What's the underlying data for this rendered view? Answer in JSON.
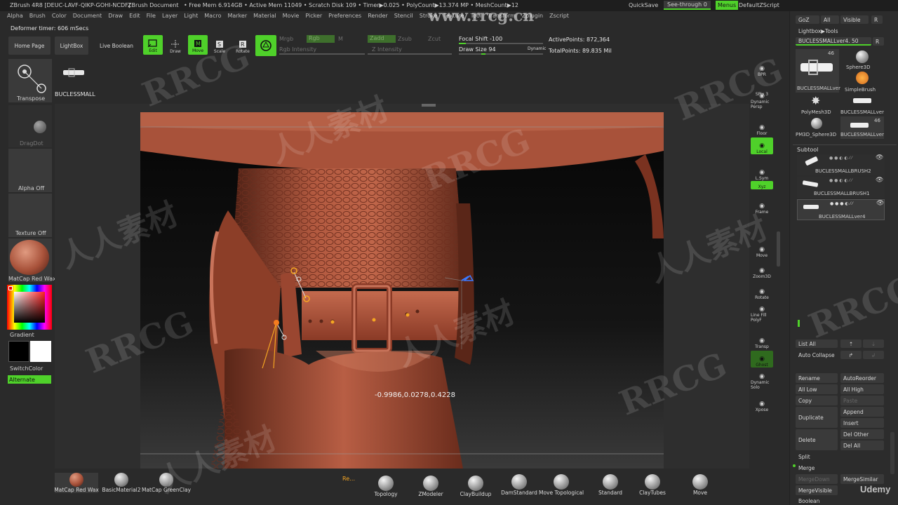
{
  "titlebar": {
    "title": "ZBrush 4R8 [DEUC-LAVF-QIKP-GOHI-NCDF]",
    "document": "ZBrush Document",
    "stats": "• Free Mem 6.914GB • Active Mem 11049 • Scratch Disk 109 • Timer▶0.025 • PolyCount▶13.374 MP • MeshCount▶12",
    "quicksave": "QuickSave",
    "seethrough": "See-through 0",
    "menus": "Menus",
    "defaultzscript": "DefaultZScript"
  },
  "menubar": [
    "Alpha",
    "Brush",
    "Color",
    "Document",
    "Draw",
    "Edit",
    "File",
    "Layer",
    "Light",
    "Macro",
    "Marker",
    "Material",
    "Movie",
    "Picker",
    "Preferences",
    "Render",
    "Stencil",
    "Stroke",
    "Texture",
    "Tool",
    "Transform",
    "Zplugin",
    "Zscript"
  ],
  "deformer": "Deformer timer: 606 mSecs",
  "toolbar": {
    "home": "Home Page",
    "lightbox": "LightBox",
    "liveboolean": "Live Boolean",
    "edit": "Edit",
    "draw": "Draw",
    "move": "Move",
    "scale": "Scale",
    "rotate": "Rotate",
    "mrgb": "Mrgb",
    "rgb": "Rgb",
    "m": "M",
    "rgb_intensity": "Rgb Intensity",
    "zadd": "Zadd",
    "zsub": "Zsub",
    "zcut": "Zcut",
    "z_intensity": "Z Intensity",
    "focal_shift": "Focal Shift -100",
    "draw_size": "Draw Size 94",
    "dynamic": "Dynamic",
    "active_points": "ActivePoints: 872,364",
    "total_points": "TotalPoints: 89.835 Mil"
  },
  "leftshelf": {
    "transpose": "Transpose",
    "dragdot": "DragDot",
    "alpha": "Alpha Off",
    "texture": "Texture Off",
    "material": "MatCap Red Wax",
    "gradient": "Gradient",
    "switchcolor": "SwitchColor",
    "alternate": "Alternate",
    "toolname": "BUCLESSMALL"
  },
  "colors": {
    "primary": "#000000",
    "secondary": "#ffffff",
    "accent": "#4fd12a",
    "model": "#a8523a"
  },
  "rightshelf": [
    "BPR",
    "SPix 3",
    "Dynamic Persp",
    "Floor",
    "Local",
    "L.Sym",
    "Xyz",
    "Frame",
    "Move",
    "Zoom3D",
    "Rotate",
    "Line Fill PolyF",
    "Transp",
    "Ghost",
    "Dynamic Solo",
    "Xpose"
  ],
  "rightpanel": {
    "goz": "GoZ",
    "all": "All",
    "visible": "Visible",
    "r": "R",
    "lightbox_tools": "Lightbox▶Tools",
    "current_tool": "BUCLESSMALLver4. 50",
    "tools": [
      {
        "name": "BUCLESSMALLver",
        "count": "46"
      },
      {
        "name": "Sphere3D",
        "count": ""
      },
      {
        "name": "SimpleBrush",
        "count": ""
      },
      {
        "name": "PolyMesh3D",
        "count": ""
      },
      {
        "name": "BUCLESSMALLver",
        "count": ""
      },
      {
        "name": "PM3D_Sphere3D",
        "count": ""
      },
      {
        "name": "BUCLESSMALLver",
        "count": "46"
      }
    ],
    "subtool_title": "Subtool",
    "subtools": [
      "BUCLESSMALLBRUSH2",
      "BUCLESSMALLBRUSH1",
      "BUCLESSMALLver4"
    ],
    "list_all": "List All",
    "auto_collapse": "Auto Collapse",
    "rename": "Rename",
    "autoreorder": "AutoReorder",
    "all_low": "All Low",
    "all_high": "All High",
    "copy": "Copy",
    "paste": "Paste",
    "append": "Append",
    "duplicate": "Duplicate",
    "insert": "Insert",
    "del_other": "Del Other",
    "delete": "Delete",
    "del_all": "Del All",
    "split": "Split",
    "merge": "Merge",
    "mergedown": "MergeDown",
    "mergesimilar": "MergeSimilar",
    "mergevisible": "MergeVisible",
    "boolean": "Boolean"
  },
  "viewport": {
    "coords": "-0.9986,0.0278,0.4228",
    "overlay": "Re…"
  },
  "bottombar": {
    "materials": [
      "MatCap Red Wax",
      "BasicMaterial2",
      "MatCap GreenClay"
    ],
    "brushes": [
      "Topology",
      "ZModeler",
      "ClayBuildup",
      "DamStandard",
      "Move Topological",
      "Standard",
      "ClayTubes",
      "Move"
    ]
  },
  "watermark": {
    "site": "www.rrcg.cn",
    "brand": "RRCG",
    "cn": "人人素材",
    "udemy": "Udemy"
  }
}
